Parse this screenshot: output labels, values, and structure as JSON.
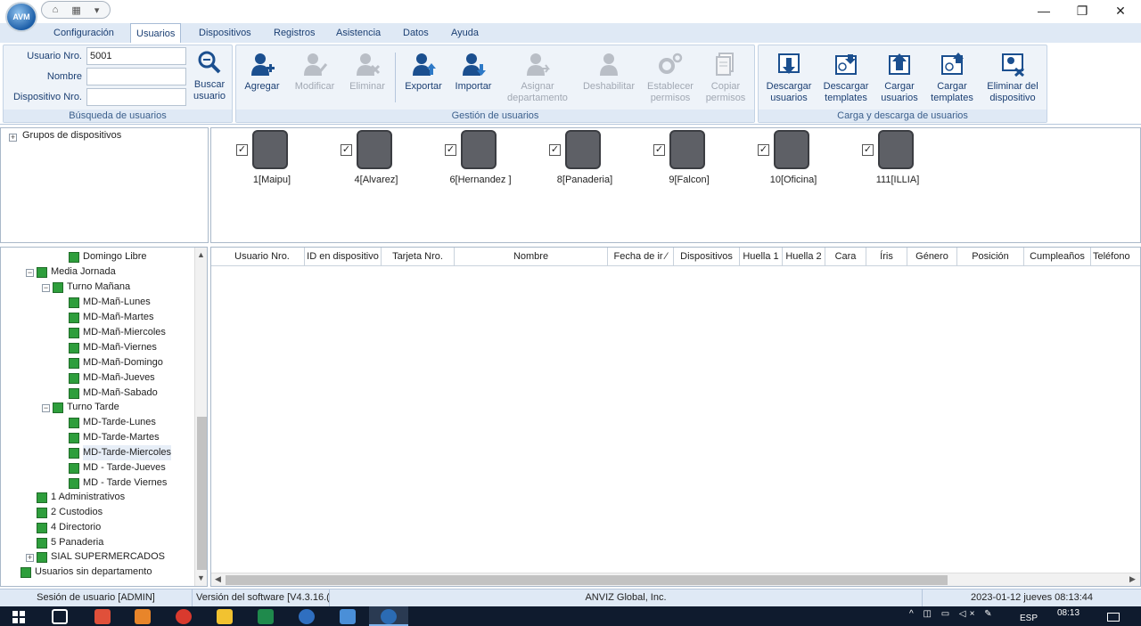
{
  "window": {
    "minimize": "—",
    "restore": "❐",
    "close": "✕"
  },
  "quick_access": {
    "home": "⌂",
    "devices": "▦",
    "menu": "▾"
  },
  "logo_text": "AVM",
  "tabs": [
    "Configuración",
    "Usuarios",
    "Dispositivos",
    "Registros",
    "Asistencia",
    "Datos",
    "Ayuda"
  ],
  "active_tab": "Usuarios",
  "search": {
    "user_no_label": "Usuario Nro.",
    "user_no_value": "5001",
    "name_label": "Nombre",
    "name_value": "",
    "device_no_label": "Dispositivo Nro.",
    "device_no_value": "",
    "button": "Buscar usuario",
    "group_label": "Búsqueda de usuarios"
  },
  "user_mgmt": {
    "buttons": [
      {
        "label": "Agregar",
        "enabled": true,
        "icon": "add-user-icon"
      },
      {
        "label": "Modificar",
        "enabled": false,
        "icon": "edit-user-icon"
      },
      {
        "label": "Eliminar",
        "enabled": false,
        "icon": "delete-user-icon"
      },
      {
        "label": "Exportar",
        "enabled": true,
        "icon": "export-user-icon"
      },
      {
        "label": "Importar",
        "enabled": true,
        "icon": "import-user-icon"
      },
      {
        "label": "Asignar departamento",
        "enabled": false,
        "icon": "assign-dept-icon"
      },
      {
        "label": "Deshabilitar",
        "enabled": false,
        "icon": "disable-user-icon"
      },
      {
        "label": "Establecer permisos",
        "enabled": false,
        "icon": "permissions-icon"
      },
      {
        "label": "Copiar permisos",
        "enabled": false,
        "icon": "copy-permissions-icon"
      }
    ],
    "group_label": "Gestión de usuarios"
  },
  "transfer": {
    "buttons": [
      {
        "label": "Descargar usuarios",
        "icon": "download-users-icon"
      },
      {
        "label": "Descargar templates",
        "icon": "download-templates-icon"
      },
      {
        "label": "Cargar usuarios",
        "icon": "upload-users-icon"
      },
      {
        "label": "Cargar templates",
        "icon": "upload-templates-icon"
      },
      {
        "label": "Eliminar del dispositivo",
        "icon": "delete-from-device-icon"
      }
    ],
    "group_label": "Carga y descarga de usuarios"
  },
  "device_groups_label": "Grupos de dispositivos",
  "devices": [
    {
      "label": "1[Maipu]",
      "checked": true
    },
    {
      "label": "4[Alvarez]",
      "checked": true
    },
    {
      "label": "6[Hernandez ]",
      "checked": true
    },
    {
      "label": "8[Panaderia]",
      "checked": true
    },
    {
      "label": "9[Falcon]",
      "checked": true
    },
    {
      "label": "10[Oficina]",
      "checked": true
    },
    {
      "label": "111[ILLIA]",
      "checked": true
    }
  ],
  "tree": [
    {
      "label": "Domingo Libre",
      "level": 3
    },
    {
      "label": "Media Jornada",
      "level": 1,
      "expander": "−"
    },
    {
      "label": "Turno Mañana",
      "level": 2,
      "expander": "−"
    },
    {
      "label": "MD-Mañ-Lunes",
      "level": 3
    },
    {
      "label": "MD-Mañ-Martes",
      "level": 3
    },
    {
      "label": "MD-Mañ-Miercoles",
      "level": 3
    },
    {
      "label": "MD-Mañ-Viernes",
      "level": 3
    },
    {
      "label": "MD-Mañ-Domingo",
      "level": 3
    },
    {
      "label": "MD-Mañ-Jueves",
      "level": 3
    },
    {
      "label": "MD-Mañ-Sabado",
      "level": 3
    },
    {
      "label": "Turno Tarde",
      "level": 2,
      "expander": "−"
    },
    {
      "label": "MD-Tarde-Lunes",
      "level": 3
    },
    {
      "label": "MD-Tarde-Martes",
      "level": 3
    },
    {
      "label": "MD-Tarde-Miercoles",
      "level": 3,
      "selected": true
    },
    {
      "label": "MD - Tarde-Jueves",
      "level": 3
    },
    {
      "label": "MD - Tarde Viernes",
      "level": 3
    },
    {
      "label": "1 Administrativos",
      "level": 1
    },
    {
      "label": "2 Custodios",
      "level": 1
    },
    {
      "label": "4 Directorio",
      "level": 1
    },
    {
      "label": "5 Panaderia",
      "level": 1
    },
    {
      "label": "SIAL SUPERMERCADOS",
      "level": 1,
      "expander": "+"
    },
    {
      "label": "Usuarios sin departamento",
      "level": 0
    }
  ],
  "columns": [
    "Usuario Nro.",
    "ID en dispositivo",
    "Tarjeta Nro.",
    "Nombre",
    "Fecha de ir ⁄",
    "Dispositivos",
    "Huella 1",
    "Huella 2",
    "Cara",
    "Íris",
    "Género",
    "Posición",
    "Cumpleaños",
    "Teléfono"
  ],
  "status": {
    "session": "Sesión de usuario  [ADMIN]",
    "version": "Versión del software  [V4.3.16.(",
    "company": "ANVIZ Global, Inc.",
    "datetime": "2023-01-12 jueves 08:13:44"
  },
  "taskbar": {
    "lang": "ESP",
    "time": "08:13",
    "tray": "^ ◫ ▭ ◁× ✎"
  }
}
